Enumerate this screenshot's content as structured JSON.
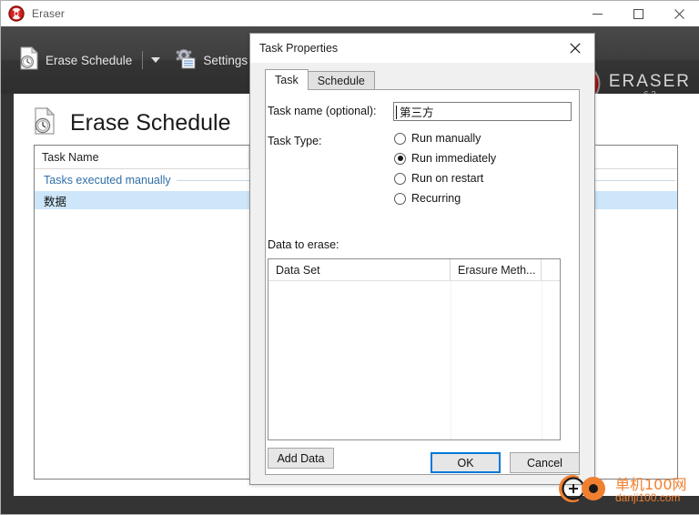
{
  "window": {
    "title": "Eraser",
    "title_icon": "eraser-radiation-icon",
    "controls": {
      "minimize": "—",
      "maximize": "□",
      "close": "✕"
    }
  },
  "toolbar": {
    "items": [
      {
        "label": "Erase Schedule",
        "icon": "erase-schedule-icon"
      },
      {
        "label": "Settings",
        "icon": "settings-gear-icon"
      },
      {
        "label": "",
        "icon": "help-question-icon"
      }
    ],
    "dropdown_caret": "▾"
  },
  "brand": {
    "name": "ERASER",
    "version": "6.2",
    "icon": "radiation-logo-icon"
  },
  "page": {
    "title": "Erase Schedule",
    "title_icon": "erase-schedule-page-icon"
  },
  "task_list": {
    "columns": [
      "Task Name",
      "",
      ""
    ],
    "group_label": "Tasks executed manually",
    "rows": [
      {
        "name": "数据",
        "selected": true
      }
    ]
  },
  "dialog": {
    "title": "Task Properties",
    "close_label": "✕",
    "tabs": [
      {
        "label": "Task",
        "active": true
      },
      {
        "label": "Schedule",
        "active": false
      }
    ],
    "task_name": {
      "label": "Task name (optional):",
      "value": "第三方",
      "placeholder": ""
    },
    "task_type": {
      "label": "Task Type:",
      "options": [
        {
          "label": "Run manually",
          "selected": false
        },
        {
          "label": "Run immediately",
          "selected": true
        },
        {
          "label": "Run on restart",
          "selected": false
        },
        {
          "label": "Recurring",
          "selected": false
        }
      ]
    },
    "data_to_erase": {
      "label": "Data to erase:",
      "columns": [
        "Data Set",
        "Erasure Meth...",
        ""
      ],
      "rows": []
    },
    "add_data_label": "Add Data",
    "ok_label": "OK",
    "cancel_label": "Cancel"
  },
  "watermark": {
    "cn": "单机100网",
    "en": "danji100.com",
    "color": "#f08030"
  },
  "colors": {
    "toolbar_dark": "#3a3a3a",
    "selection_blue": "#cde6fa",
    "group_link": "#2f6fa8",
    "focus_blue": "#0078d7"
  }
}
